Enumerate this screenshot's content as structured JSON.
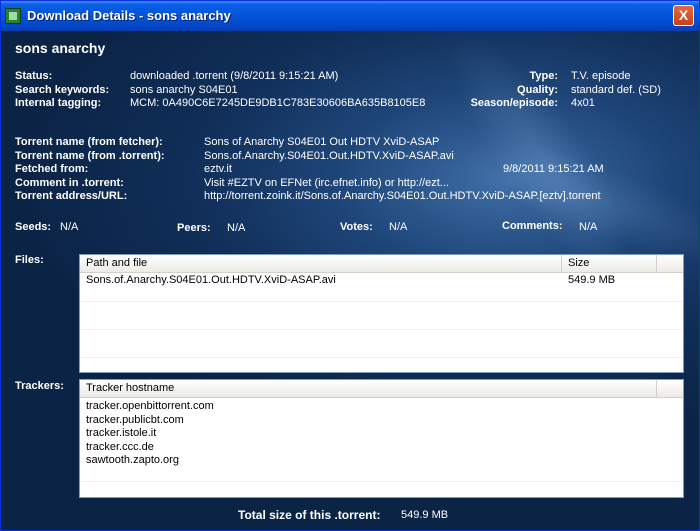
{
  "window": {
    "title": "Download Details - sons anarchy",
    "close_label": "X"
  },
  "heading": "sons anarchy",
  "info": {
    "status_label": "Status:",
    "status_value": "downloaded .torrent (9/8/2011 9:15:21 AM)",
    "keywords_label": "Search keywords:",
    "keywords_value": "sons anarchy S04E01",
    "tagging_label": "Internal tagging:",
    "tagging_value": "MCM: 0A490C6E7245DE9DB1C783E30606BA635B8105E8",
    "type_label": "Type:",
    "type_value": "T.V. episode",
    "quality_label": "Quality:",
    "quality_value": "standard def. (SD)",
    "season_label": "Season/episode:",
    "season_value": "4x01"
  },
  "torrent": {
    "name_fetcher_label": "Torrent name (from fetcher):",
    "name_fetcher_value": "Sons of Anarchy S04E01 Out HDTV XviD-ASAP",
    "name_torrent_label": "Torrent name (from .torrent):",
    "name_torrent_value": "Sons.of.Anarchy.S04E01.Out.HDTV.XviD-ASAP.avi",
    "fetched_label": "Fetched from:",
    "fetched_value": "eztv.it",
    "fetched_time": "9/8/2011 9:15:21 AM",
    "comment_label": "Comment in .torrent:",
    "comment_value": "Visit #EZTV on EFNet (irc.efnet.info) or http://ezt...",
    "address_label": "Torrent address/URL:",
    "address_value": "http://torrent.zoink.it/Sons.of.Anarchy.S04E01.Out.HDTV.XviD-ASAP.[eztv].torrent"
  },
  "stats": {
    "seeds_label": "Seeds:",
    "seeds_value": "N/A",
    "peers_label": "Peers:",
    "peers_value": "N/A",
    "votes_label": "Votes:",
    "votes_value": "N/A",
    "comments_label": "Comments:",
    "comments_value": "N/A"
  },
  "files": {
    "label": "Files:",
    "col_path": "Path and file",
    "col_size": "Size",
    "rows": [
      {
        "path": "Sons.of.Anarchy.S04E01.Out.HDTV.XviD-ASAP.avi",
        "size": "549.9 MB"
      }
    ]
  },
  "trackers": {
    "label": "Trackers:",
    "col_host": "Tracker hostname",
    "rows": [
      "tracker.openbittorrent.com",
      "tracker.publicbt.com",
      "tracker.istole.it",
      "tracker.ccc.de",
      "sawtooth.zapto.org"
    ]
  },
  "footer": {
    "total_label": "Total size of this .torrent:",
    "total_value": "549.9 MB"
  }
}
